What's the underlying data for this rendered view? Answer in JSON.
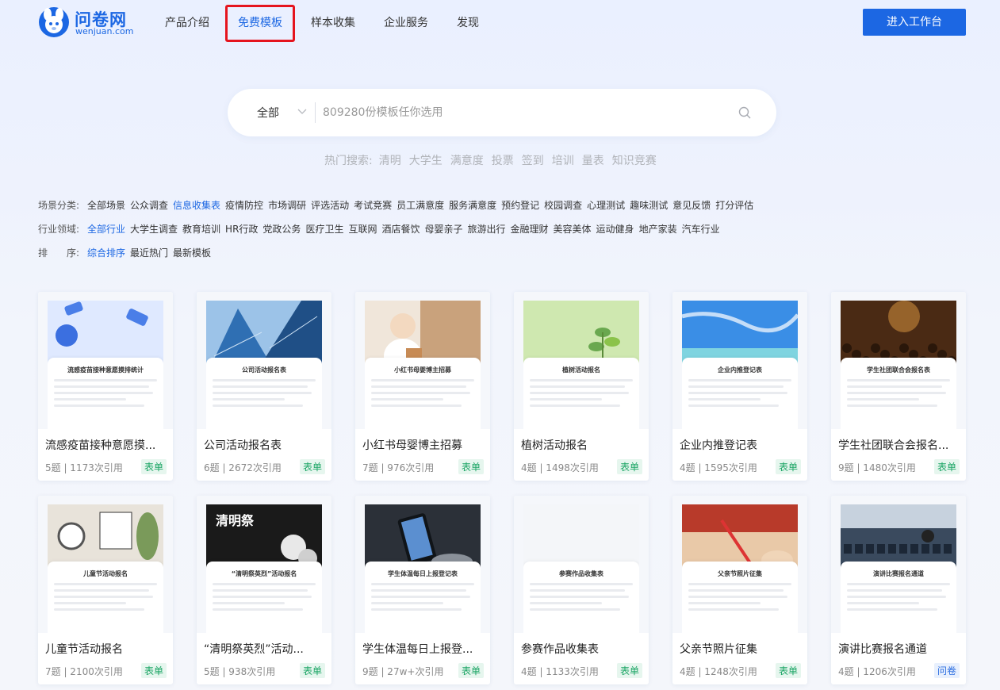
{
  "header": {
    "logo_name": "问卷网",
    "logo_domain": "wenjuan.com",
    "nav": [
      {
        "label": "产品介绍",
        "active": false
      },
      {
        "label": "免费模板",
        "active": true
      },
      {
        "label": "样本收集",
        "active": false
      },
      {
        "label": "企业服务",
        "active": false
      },
      {
        "label": "发现",
        "active": false
      }
    ],
    "cta_label": "进入工作台"
  },
  "search": {
    "scope": "全部",
    "placeholder": "809280份模板任你选用",
    "hot_label": "热门搜索:",
    "hot_terms": [
      "清明",
      "大学生",
      "满意度",
      "投票",
      "签到",
      "培训",
      "量表",
      "知识竞赛"
    ]
  },
  "filters": {
    "scene": {
      "label": "场景分类:",
      "options": [
        "全部场景",
        "公众调查",
        "信息收集表",
        "疫情防控",
        "市场调研",
        "评选活动",
        "考试竞赛",
        "员工满意度",
        "服务满意度",
        "预约登记",
        "校园调查",
        "心理测试",
        "趣味测试",
        "意见反馈",
        "打分评估"
      ],
      "selected": 2
    },
    "industry": {
      "label": "行业领域:",
      "options": [
        "全部行业",
        "大学生调查",
        "教育培训",
        "HR行政",
        "党政公务",
        "医疗卫生",
        "互联网",
        "酒店餐饮",
        "母婴亲子",
        "旅游出行",
        "金融理财",
        "美容美体",
        "运动健身",
        "地产家装",
        "汽车行业"
      ],
      "selected": 0
    },
    "sort": {
      "label": "排　　序:",
      "options": [
        "综合排序",
        "最近热门",
        "最新模板"
      ],
      "selected": 0
    }
  },
  "templates": [
    {
      "title": "流感疫苗接种意愿摸...",
      "meta": "5题 | 1173次引用",
      "tag": "表单",
      "tag_type": "form",
      "paper_title": "流感疫苗接种意愿摸排统计",
      "art": "flu",
      "colors": [
        "#dfe9ff",
        "#ffffff"
      ]
    },
    {
      "title": "公司活动报名表",
      "meta": "6题 | 2672次引用",
      "tag": "表单",
      "tag_type": "form",
      "paper_title": "公司活动报名表",
      "art": "building",
      "colors": [
        "#2f6fb3",
        "#9cc3e8"
      ]
    },
    {
      "title": "小红书母婴博主招募",
      "meta": "7题 | 976次引用",
      "tag": "表单",
      "tag_type": "form",
      "paper_title": "小红书母婴博主招募",
      "art": "baby",
      "colors": [
        "#f0e6da",
        "#c9a27c"
      ]
    },
    {
      "title": "植树活动报名",
      "meta": "4题 | 1498次引用",
      "tag": "表单",
      "tag_type": "form",
      "paper_title": "植树活动报名",
      "art": "plant",
      "colors": [
        "#cfe8b0",
        "#6aa84f"
      ]
    },
    {
      "title": "企业内推登记表",
      "meta": "4题 | 1595次引用",
      "tag": "表单",
      "tag_type": "form",
      "paper_title": "企业内推登记表",
      "art": "sea",
      "colors": [
        "#3a8ee6",
        "#7fd4e0"
      ]
    },
    {
      "title": "学生社团联合会报名...",
      "meta": "9题 | 1480次引用",
      "tag": "表单",
      "tag_type": "form",
      "paper_title": "学生社团联合会报名表",
      "art": "crowd",
      "colors": [
        "#4a2a14",
        "#c98a3a"
      ]
    },
    {
      "title": "儿童节活动报名",
      "meta": "7题 | 2100次引用",
      "tag": "表单",
      "tag_type": "form",
      "paper_title": "儿童节活动报名",
      "art": "desk",
      "colors": [
        "#e8e3da",
        "#7a9a5a"
      ]
    },
    {
      "title": "“清明祭英烈”活动...",
      "meta": "5题 | 938次引用",
      "tag": "表单",
      "tag_type": "form",
      "paper_title": "“清明祭英烈”活动报名",
      "art": "qingming",
      "colors": [
        "#1a1a1a",
        "#e8e8e8"
      ],
      "art_text": "清明祭"
    },
    {
      "title": "学生体温每日上报登...",
      "meta": "9题 | 27w+次引用",
      "tag": "表单",
      "tag_type": "form",
      "paper_title": "学生体温每日上报登记表",
      "art": "phone",
      "colors": [
        "#2b3038",
        "#8a9099"
      ]
    },
    {
      "title": "参赛作品收集表",
      "meta": "4题 | 1133次引用",
      "tag": "表单",
      "tag_type": "form",
      "paper_title": "参赛作品收集表",
      "art": "plain",
      "colors": [
        "#f4f6f9",
        "#ffffff"
      ]
    },
    {
      "title": "父亲节照片征集",
      "meta": "4题 | 1248次引用",
      "tag": "表单",
      "tag_type": "form",
      "paper_title": "父亲节照片征集",
      "art": "drawing",
      "colors": [
        "#b83a2a",
        "#e9c9a8"
      ]
    },
    {
      "title": "演讲比赛报名通道",
      "meta": "4题 | 1206次引用",
      "tag": "问卷",
      "tag_type": "survey",
      "paper_title": "演讲比赛报名通道",
      "art": "hall",
      "colors": [
        "#3a4a5e",
        "#c7d2de"
      ]
    }
  ]
}
